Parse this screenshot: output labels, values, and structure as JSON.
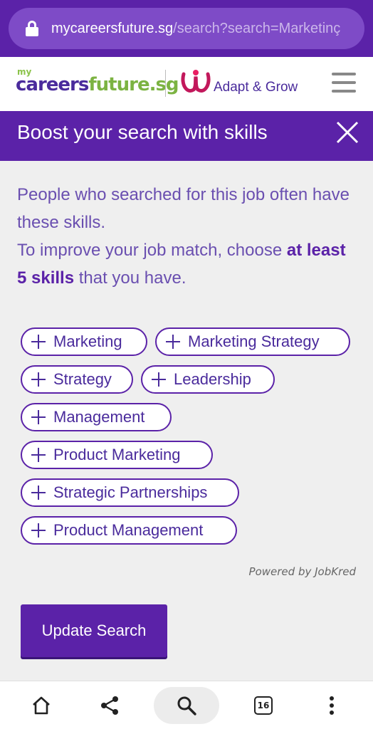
{
  "browser": {
    "url_host": "mycareersfuture.sg",
    "url_path": "/search?search=Marketinç",
    "tab_count": "16"
  },
  "header": {
    "logo_my": "my",
    "logo_careers": "careers",
    "logo_future": "future.sg",
    "partner_text": "Adapt & Grow"
  },
  "banner": {
    "title": "Boost your search with skills"
  },
  "intro": {
    "line1": "People who searched for this job often have these skills.",
    "line2_pre": "To improve your job match, choose ",
    "line2_bold": "at least 5 skills",
    "line2_post": " that you have."
  },
  "skills": [
    "Marketing",
    "Marketing Strategy",
    "Strategy",
    "Leadership",
    "Management",
    "Product Marketing",
    "Strategic Partnerships",
    "Product Management"
  ],
  "powered_by": "Powered by JobKred",
  "update_button": "Update Search",
  "colors": {
    "brand_purple": "#5b22a8",
    "brand_green": "#7cb342"
  }
}
